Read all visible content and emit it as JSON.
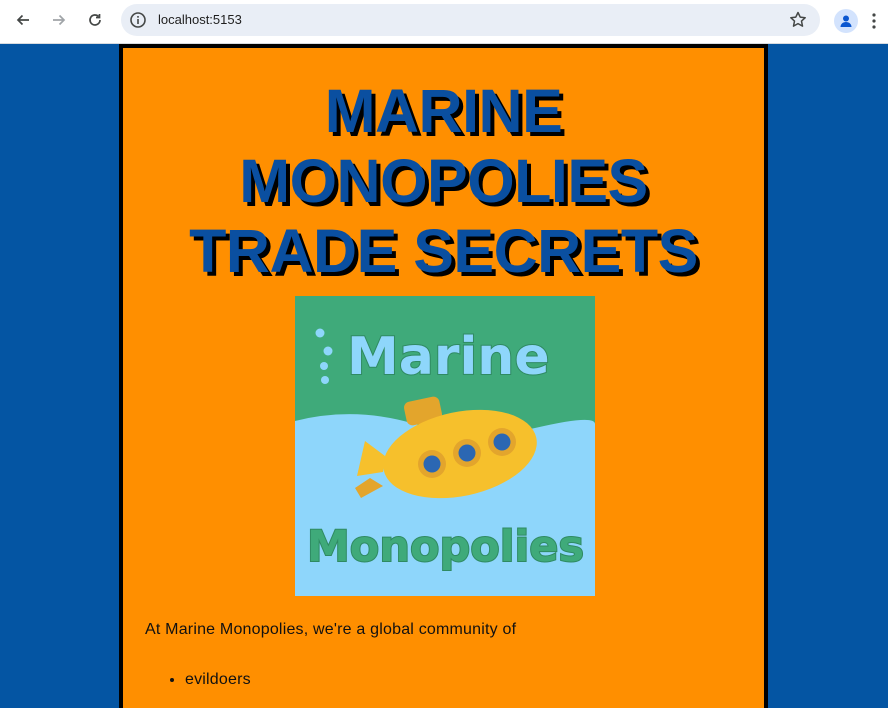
{
  "browser": {
    "url": "localhost:5153",
    "icons": {
      "back": "back-arrow-icon",
      "forward": "forward-arrow-icon",
      "reload": "reload-icon",
      "info": "info-icon",
      "bookmark": "star-icon",
      "profile": "profile-icon",
      "menu": "kebab-menu-icon"
    }
  },
  "page": {
    "title_lines": [
      "MARINE",
      "MONOPOLIES",
      "TRADE SECRETS"
    ],
    "logo": {
      "top_text": "Marine",
      "bottom_text": "Monopolies"
    },
    "intro": "At Marine Monopolies, we're a global community of",
    "list": [
      "evildoers"
    ]
  },
  "colors": {
    "background": "#0455a3",
    "panel": "#ff8f00",
    "title": "#0a4fa0",
    "logo_green": "#3faa7a",
    "logo_water": "#8ed6fb",
    "submarine": "#f6c02c"
  }
}
